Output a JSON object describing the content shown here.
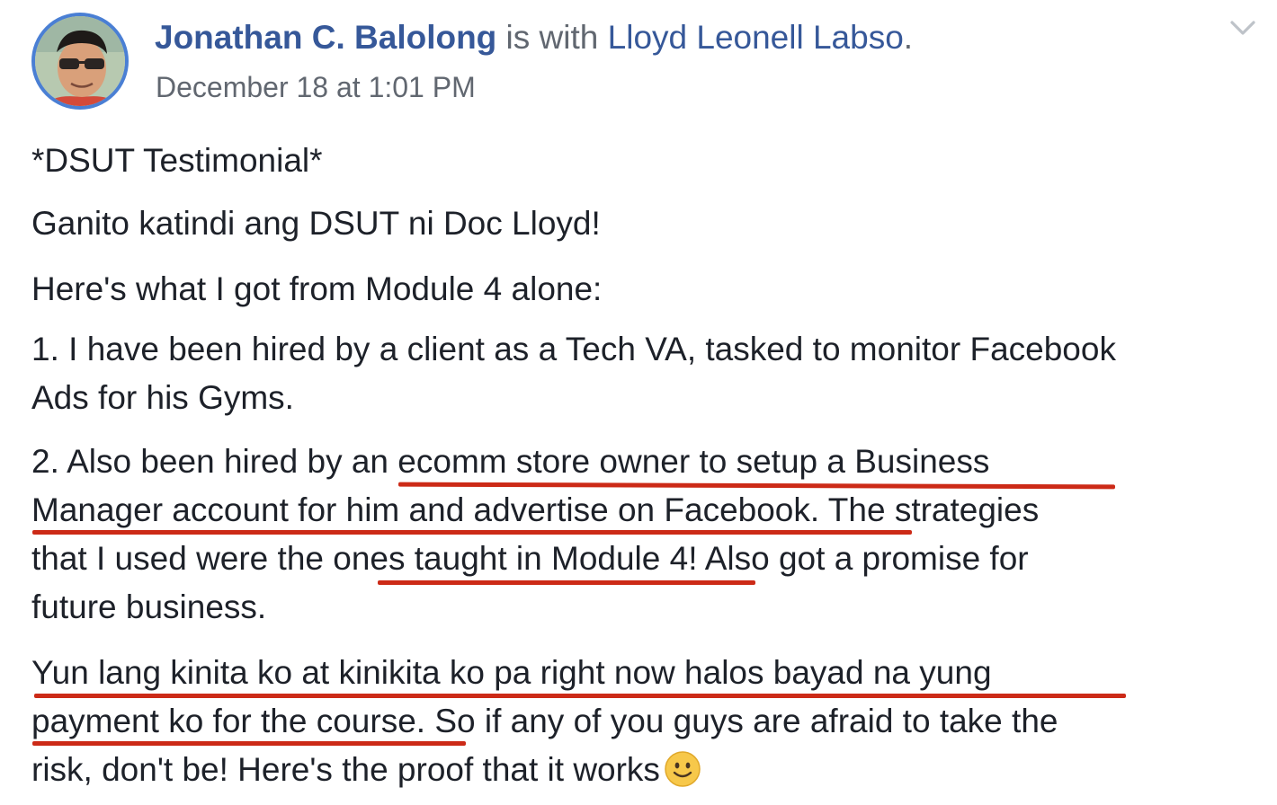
{
  "post": {
    "author_name": "Jonathan C. Balolong",
    "with_text": " is with ",
    "tagged_name": "Lloyd Leonell Labso",
    "period": ".",
    "timestamp": "December 18 at 1:01 PM",
    "options_icon": "chevron-down-icon",
    "colors": {
      "link": "#365899",
      "meta": "#616770",
      "text": "#1d2129",
      "avatar_ring": "#4a7fd4",
      "highlight_underline": "#cc2a17"
    }
  },
  "content": {
    "p1": "*DSUT Testimonial*",
    "p2": "Ganito katindi ang DSUT ni Doc Lloyd!",
    "p3": "Here's what I got from Module 4 alone:",
    "p4_l1": "1. I have been hired by a client as a Tech VA, tasked to monitor Facebook",
    "p4_l2": "Ads for his Gyms.",
    "p5_l1": "2. Also been hired by an ecomm store owner to setup a Business",
    "p5_l2": "Manager account for him and advertise on Facebook. The strategies",
    "p5_l3": "that I used were the ones taught in Module 4! Also got a promise for",
    "p5_l4": "future business.",
    "p6_l1": "Yun lang kinita ko at kinikita ko pa right now halos bayad na yung",
    "p6_l2": "payment ko for the course. So if any of you guys are afraid to take the",
    "p6_l3": "risk, don't be! Here's the proof that it works",
    "emoji": "smiley-emoji-icon"
  }
}
